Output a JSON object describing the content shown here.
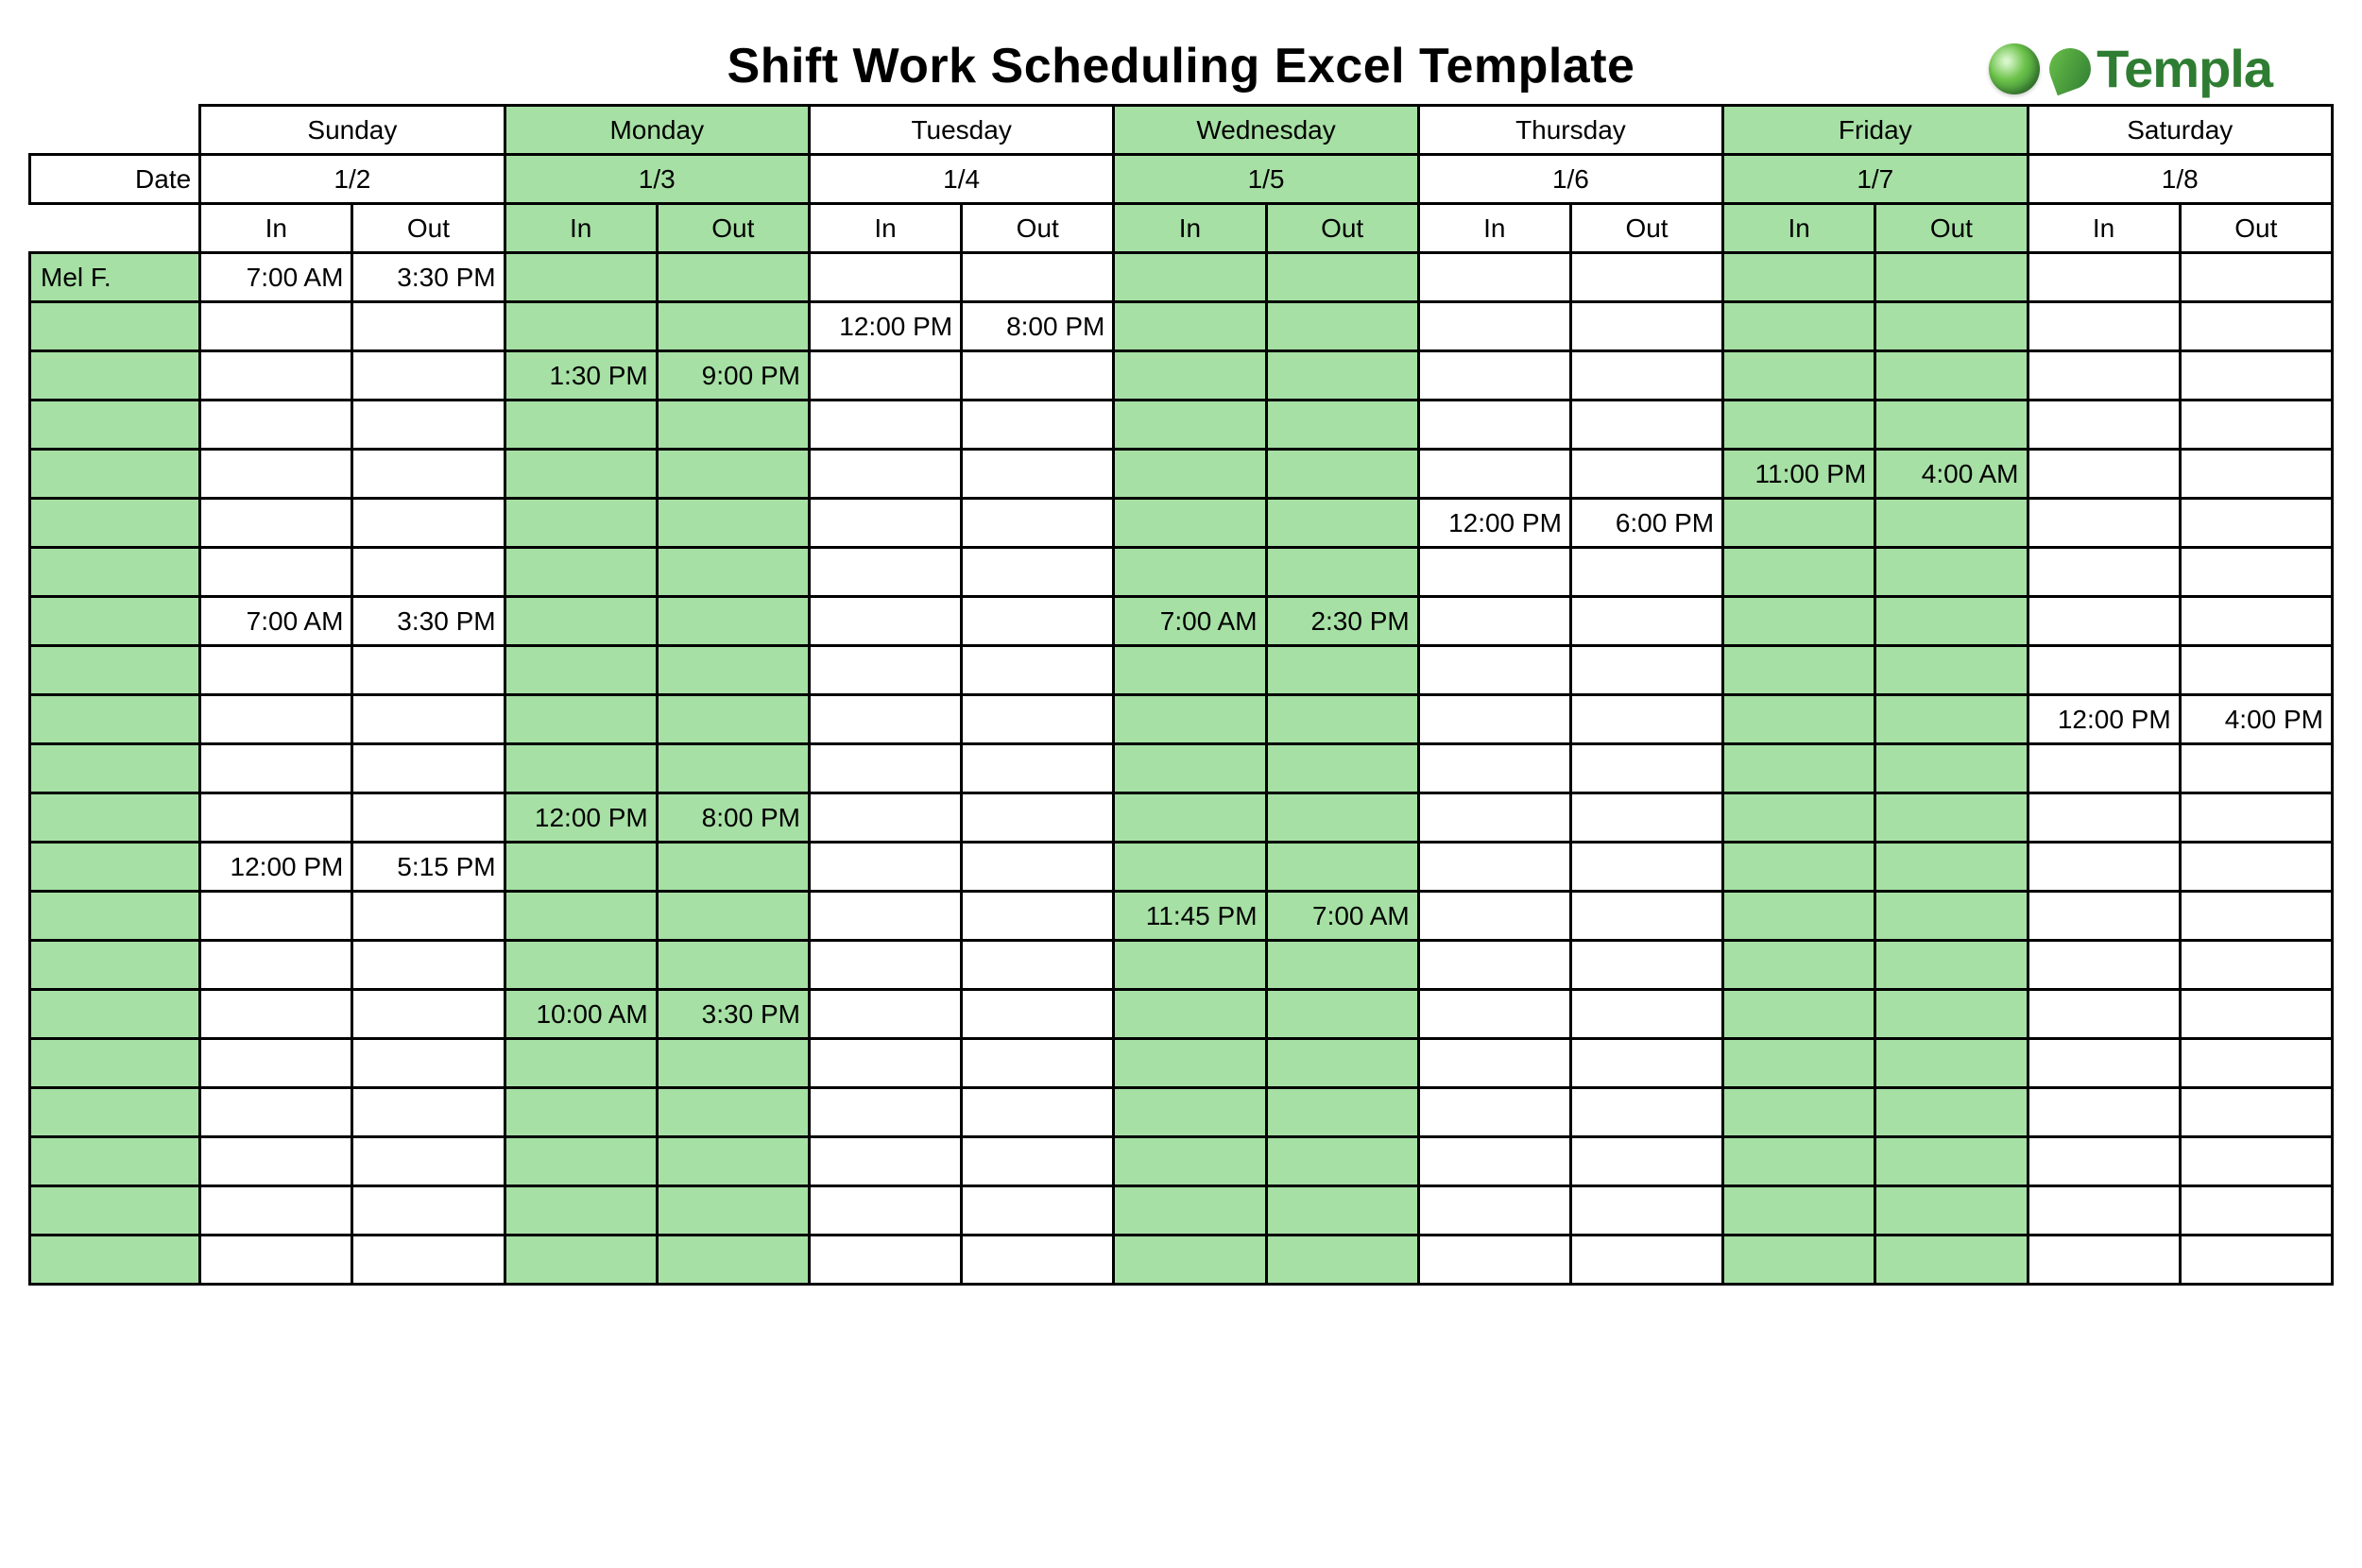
{
  "title": "Shift Work Scheduling Excel Template",
  "logo_text": "Templa",
  "date_label": "Date",
  "io_labels": {
    "in": "In",
    "out": "Out"
  },
  "days": [
    {
      "name": "Sunday",
      "date": "1/2",
      "green": false
    },
    {
      "name": "Monday",
      "date": "1/3",
      "green": true
    },
    {
      "name": "Tuesday",
      "date": "1/4",
      "green": false
    },
    {
      "name": "Wednesday",
      "date": "1/5",
      "green": true
    },
    {
      "name": "Thursday",
      "date": "1/6",
      "green": false
    },
    {
      "name": "Friday",
      "date": "1/7",
      "green": true
    },
    {
      "name": "Saturday",
      "date": "1/8",
      "green": false
    }
  ],
  "rows": [
    {
      "name": "Mel F.",
      "cells": [
        [
          "7:00 AM",
          "3:30 PM"
        ],
        [
          "",
          ""
        ],
        [
          "",
          ""
        ],
        [
          "",
          ""
        ],
        [
          "",
          ""
        ],
        [
          "",
          ""
        ],
        [
          "",
          ""
        ]
      ]
    },
    {
      "name": "",
      "cells": [
        [
          "",
          ""
        ],
        [
          "",
          ""
        ],
        [
          "12:00 PM",
          "8:00 PM"
        ],
        [
          "",
          ""
        ],
        [
          "",
          ""
        ],
        [
          "",
          ""
        ],
        [
          "",
          ""
        ]
      ]
    },
    {
      "name": "",
      "cells": [
        [
          "",
          ""
        ],
        [
          "1:30 PM",
          "9:00 PM"
        ],
        [
          "",
          ""
        ],
        [
          "",
          ""
        ],
        [
          "",
          ""
        ],
        [
          "",
          ""
        ],
        [
          "",
          ""
        ]
      ]
    },
    {
      "name": "",
      "cells": [
        [
          "",
          ""
        ],
        [
          "",
          ""
        ],
        [
          "",
          ""
        ],
        [
          "",
          ""
        ],
        [
          "",
          ""
        ],
        [
          "",
          ""
        ],
        [
          "",
          ""
        ]
      ]
    },
    {
      "name": "",
      "cells": [
        [
          "",
          ""
        ],
        [
          "",
          ""
        ],
        [
          "",
          ""
        ],
        [
          "",
          ""
        ],
        [
          "",
          ""
        ],
        [
          "11:00 PM",
          "4:00 AM"
        ],
        [
          "",
          ""
        ]
      ]
    },
    {
      "name": "",
      "cells": [
        [
          "",
          ""
        ],
        [
          "",
          ""
        ],
        [
          "",
          ""
        ],
        [
          "",
          ""
        ],
        [
          "12:00 PM",
          "6:00 PM"
        ],
        [
          "",
          ""
        ],
        [
          "",
          ""
        ]
      ]
    },
    {
      "name": "",
      "cells": [
        [
          "",
          ""
        ],
        [
          "",
          ""
        ],
        [
          "",
          ""
        ],
        [
          "",
          ""
        ],
        [
          "",
          ""
        ],
        [
          "",
          ""
        ],
        [
          "",
          ""
        ]
      ]
    },
    {
      "name": "",
      "cells": [
        [
          "7:00 AM",
          "3:30 PM"
        ],
        [
          "",
          ""
        ],
        [
          "",
          ""
        ],
        [
          "7:00 AM",
          "2:30 PM"
        ],
        [
          "",
          ""
        ],
        [
          "",
          ""
        ],
        [
          "",
          ""
        ]
      ]
    },
    {
      "name": "",
      "cells": [
        [
          "",
          ""
        ],
        [
          "",
          ""
        ],
        [
          "",
          ""
        ],
        [
          "",
          ""
        ],
        [
          "",
          ""
        ],
        [
          "",
          ""
        ],
        [
          "",
          ""
        ]
      ]
    },
    {
      "name": "",
      "cells": [
        [
          "",
          ""
        ],
        [
          "",
          ""
        ],
        [
          "",
          ""
        ],
        [
          "",
          ""
        ],
        [
          "",
          ""
        ],
        [
          "",
          ""
        ],
        [
          "12:00 PM",
          "4:00 PM"
        ]
      ]
    },
    {
      "name": "",
      "cells": [
        [
          "",
          ""
        ],
        [
          "",
          ""
        ],
        [
          "",
          ""
        ],
        [
          "",
          ""
        ],
        [
          "",
          ""
        ],
        [
          "",
          ""
        ],
        [
          "",
          ""
        ]
      ]
    },
    {
      "name": "",
      "cells": [
        [
          "",
          ""
        ],
        [
          "12:00 PM",
          "8:00 PM"
        ],
        [
          "",
          ""
        ],
        [
          "",
          ""
        ],
        [
          "",
          ""
        ],
        [
          "",
          ""
        ],
        [
          "",
          ""
        ]
      ]
    },
    {
      "name": "",
      "cells": [
        [
          "12:00 PM",
          "5:15 PM"
        ],
        [
          "",
          ""
        ],
        [
          "",
          ""
        ],
        [
          "",
          ""
        ],
        [
          "",
          ""
        ],
        [
          "",
          ""
        ],
        [
          "",
          ""
        ]
      ]
    },
    {
      "name": "",
      "cells": [
        [
          "",
          ""
        ],
        [
          "",
          ""
        ],
        [
          "",
          ""
        ],
        [
          "11:45 PM",
          "7:00 AM"
        ],
        [
          "",
          ""
        ],
        [
          "",
          ""
        ],
        [
          "",
          ""
        ]
      ]
    },
    {
      "name": "",
      "cells": [
        [
          "",
          ""
        ],
        [
          "",
          ""
        ],
        [
          "",
          ""
        ],
        [
          "",
          ""
        ],
        [
          "",
          ""
        ],
        [
          "",
          ""
        ],
        [
          "",
          ""
        ]
      ]
    },
    {
      "name": "",
      "cells": [
        [
          "",
          ""
        ],
        [
          "10:00 AM",
          "3:30 PM"
        ],
        [
          "",
          ""
        ],
        [
          "",
          ""
        ],
        [
          "",
          ""
        ],
        [
          "",
          ""
        ],
        [
          "",
          ""
        ]
      ]
    },
    {
      "name": "",
      "cells": [
        [
          "",
          ""
        ],
        [
          "",
          ""
        ],
        [
          "",
          ""
        ],
        [
          "",
          ""
        ],
        [
          "",
          ""
        ],
        [
          "",
          ""
        ],
        [
          "",
          ""
        ]
      ]
    },
    {
      "name": "",
      "cells": [
        [
          "",
          ""
        ],
        [
          "",
          ""
        ],
        [
          "",
          ""
        ],
        [
          "",
          ""
        ],
        [
          "",
          ""
        ],
        [
          "",
          ""
        ],
        [
          "",
          ""
        ]
      ]
    },
    {
      "name": "",
      "cells": [
        [
          "",
          ""
        ],
        [
          "",
          ""
        ],
        [
          "",
          ""
        ],
        [
          "",
          ""
        ],
        [
          "",
          ""
        ],
        [
          "",
          ""
        ],
        [
          "",
          ""
        ]
      ]
    },
    {
      "name": "",
      "cells": [
        [
          "",
          ""
        ],
        [
          "",
          ""
        ],
        [
          "",
          ""
        ],
        [
          "",
          ""
        ],
        [
          "",
          ""
        ],
        [
          "",
          ""
        ],
        [
          "",
          ""
        ]
      ]
    },
    {
      "name": "",
      "cells": [
        [
          "",
          ""
        ],
        [
          "",
          ""
        ],
        [
          "",
          ""
        ],
        [
          "",
          ""
        ],
        [
          "",
          ""
        ],
        [
          "",
          ""
        ],
        [
          "",
          ""
        ]
      ]
    }
  ]
}
